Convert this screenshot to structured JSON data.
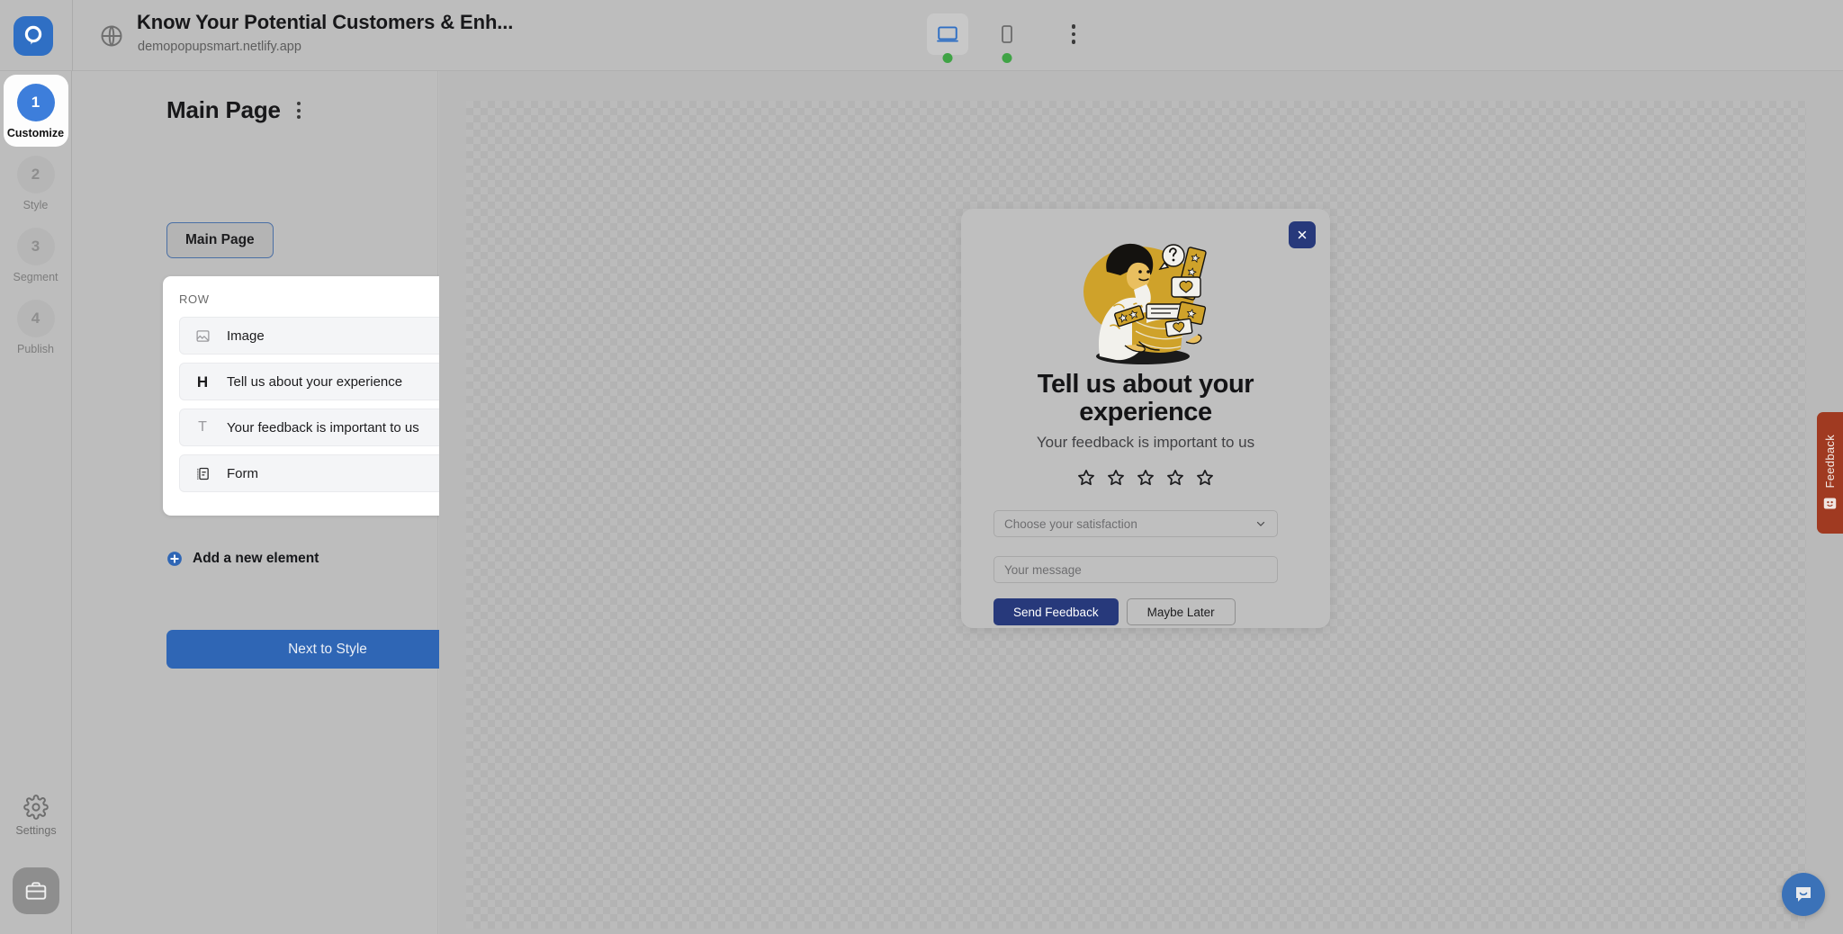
{
  "topbar": {
    "logo_icon": "popupsmart-logo-icon",
    "globe_icon": "globe-icon",
    "site_title": "Know Your Potential Customers & Enh...",
    "site_url": "demopopupsmart.netlify.app",
    "devices": [
      {
        "name": "desktop",
        "icon": "desktop-icon",
        "active": true,
        "status": "online"
      },
      {
        "name": "mobile",
        "icon": "mobile-icon",
        "active": false,
        "status": "online"
      }
    ],
    "more_menu_icon": "kebab-menu-icon"
  },
  "rail": {
    "steps": [
      {
        "number": "1",
        "label": "Customize",
        "active": true
      },
      {
        "number": "2",
        "label": "Style",
        "active": false
      },
      {
        "number": "3",
        "label": "Segment",
        "active": false
      },
      {
        "number": "4",
        "label": "Publish",
        "active": false
      }
    ],
    "settings_label": "Settings",
    "settings_icon": "gear-icon",
    "briefcase_icon": "briefcase-icon"
  },
  "panel": {
    "page_title": "Main Page",
    "page_menu_icon": "kebab-menu-icon",
    "select_indicator_icon": "radio-selected-icon",
    "add_badge_icon": "plus-badge-icon",
    "page_tab_label": "Main Page",
    "row_label": "ROW",
    "row_radio_icon": "radio-selected-icon",
    "elements": [
      {
        "icon": "image-icon",
        "label": "Image"
      },
      {
        "icon": "heading-icon",
        "label": "Tell us about your experience"
      },
      {
        "icon": "text-icon",
        "label": "Your feedback is important to us"
      },
      {
        "icon": "form-icon",
        "label": "Form"
      }
    ],
    "add_element_label": "Add a new element",
    "add_element_icon": "plus-circle-icon",
    "next_button_label": "Next to Style"
  },
  "popup": {
    "close_icon": "close-icon",
    "illustration_name": "woman-with-feedback-basket-illustration",
    "heading": "Tell us about your experience",
    "subheading": "Your feedback is important to us",
    "rating": {
      "icon": "star-outline-icon",
      "count": 5,
      "selected": 0
    },
    "select_placeholder": "Choose your satisfaction",
    "select_caret_icon": "chevron-down-icon",
    "message_placeholder": "Your message",
    "primary_button": "Send Feedback",
    "secondary_button": "Maybe Later"
  },
  "widgets": {
    "feedback_tab_label": "Feedback",
    "feedback_tab_icon": "smiley-icon",
    "chat_launcher_icon": "chat-bubble-icon"
  },
  "colors": {
    "accent_blue": "#3d7edb",
    "button_blue": "#2f66b5",
    "popup_navy": "#27397b",
    "feedback_red": "#a03a21",
    "status_green": "#3fa345",
    "illustration_gold": "#cfa22a"
  }
}
